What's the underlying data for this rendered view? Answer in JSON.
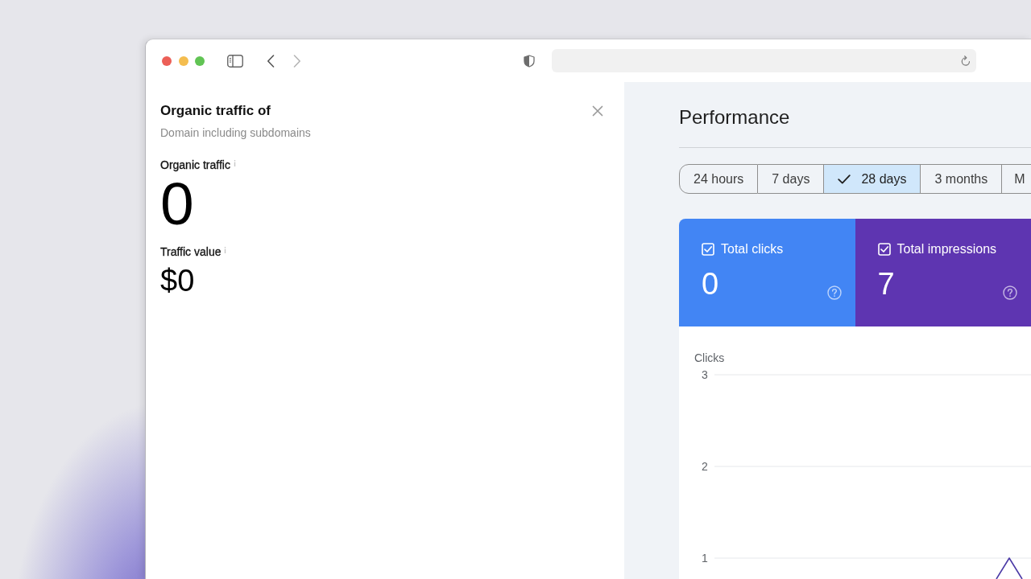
{
  "side_panel": {
    "title": "Organic traffic of",
    "subtitle": "Domain including subdomains",
    "metrics": [
      {
        "kind": "primary",
        "label": "Organic traffic",
        "value": "0"
      },
      {
        "kind": "secondary",
        "label": "Traffic value",
        "value": "$0"
      }
    ]
  },
  "performance": {
    "title": "Performance",
    "ranges": [
      {
        "label": "24 hours",
        "selected": false
      },
      {
        "label": "7 days",
        "selected": false
      },
      {
        "label": "28 days",
        "selected": true
      },
      {
        "label": "3 months",
        "selected": false
      },
      {
        "label": "M",
        "selected": false
      }
    ],
    "cards": [
      {
        "label": "Total clicks",
        "value": "0",
        "checked": true,
        "color": "#4285f4"
      },
      {
        "label": "Total impressions",
        "value": "7",
        "checked": true,
        "color": "#5e35b1"
      }
    ],
    "chart": {
      "axis_label": "Clicks",
      "ticks": [
        "3",
        "2",
        "1"
      ]
    }
  }
}
